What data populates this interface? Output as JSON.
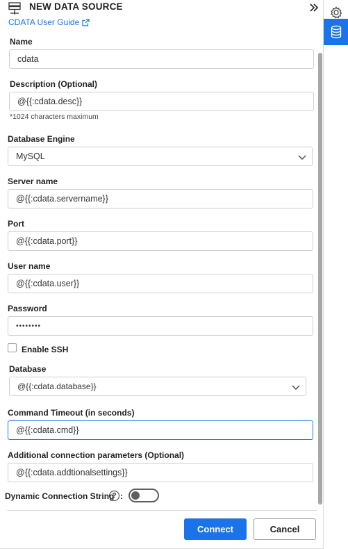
{
  "header": {
    "title": "NEW DATA SOURCE",
    "guide_link": "CDATA User Guide"
  },
  "form": {
    "name": {
      "label": "Name",
      "value": "cdata"
    },
    "description": {
      "label": "Description (Optional)",
      "value": "@{{:cdata.desc}}",
      "hint": "*1024 characters maximum"
    },
    "engine": {
      "label": "Database Engine",
      "value": "MySQL"
    },
    "server": {
      "label": "Server name",
      "value": "@{{:cdata.servername}}"
    },
    "port": {
      "label": "Port",
      "value": "@{{:cdata.port}}"
    },
    "user": {
      "label": "User name",
      "value": "@{{:cdata.user}}"
    },
    "password": {
      "label": "Password",
      "value": "••••••••"
    },
    "ssh": {
      "label": "Enable SSH",
      "checked": false
    },
    "database": {
      "label": "Database",
      "value": "@{{:cdata.database}}"
    },
    "timeout": {
      "label": "Command Timeout (in seconds)",
      "value": "@{{:cdata.cmd}}"
    },
    "additional": {
      "label": "Additional connection parameters (Optional)",
      "value": "@{{:cdata.addtionalsettings}}"
    },
    "dynamic": {
      "label": "Dynamic Connection String",
      "help": "?",
      "colon": ":",
      "enabled": false
    }
  },
  "actions": {
    "connect": "Connect",
    "cancel": "Cancel"
  },
  "rail": {
    "items": [
      "gear-icon",
      "database-icon"
    ]
  },
  "colors": {
    "accent": "#1a73e8",
    "border": "#cfcfcf",
    "text": "#222222"
  }
}
